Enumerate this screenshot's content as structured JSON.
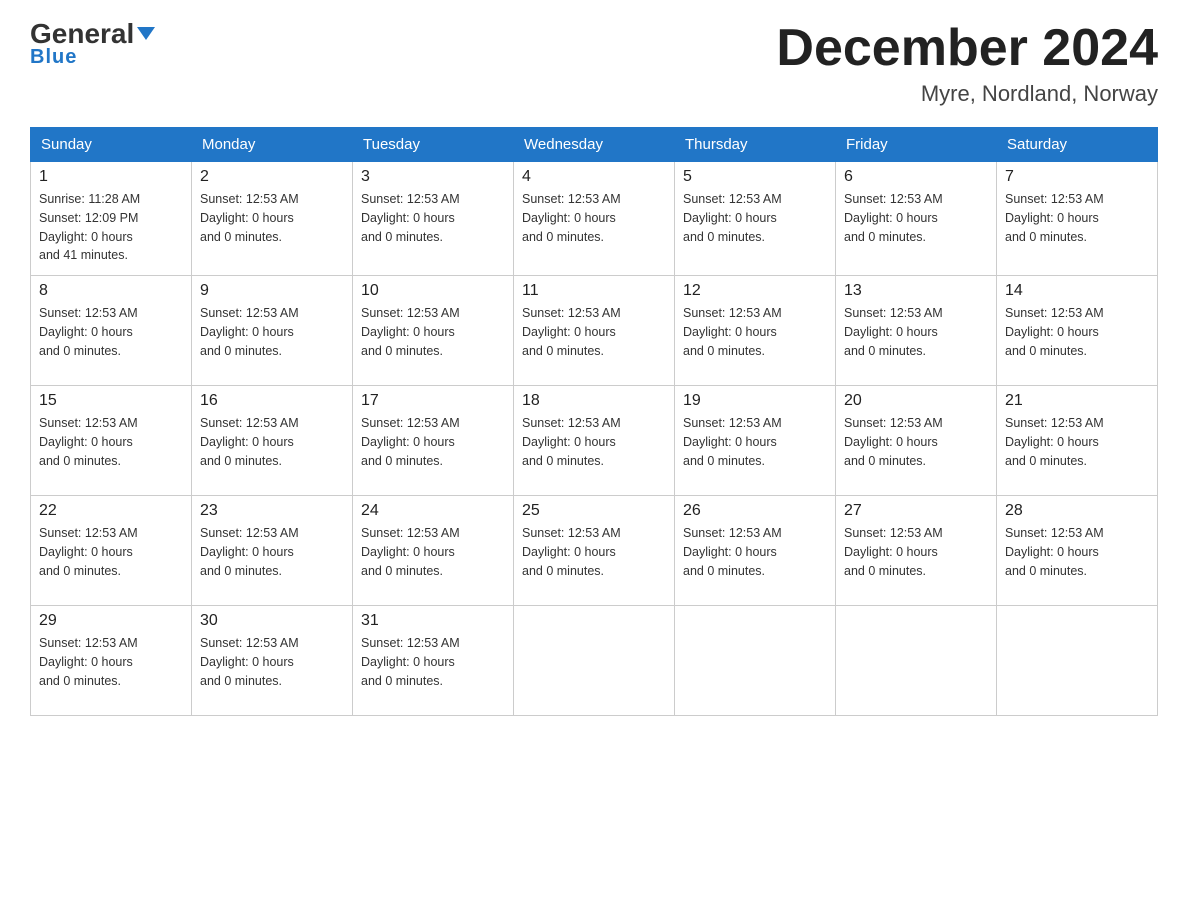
{
  "logo": {
    "general": "General",
    "blue": "Blue",
    "tagline": "Blue"
  },
  "header": {
    "month_year": "December 2024",
    "location": "Myre, Nordland, Norway"
  },
  "days_of_week": [
    "Sunday",
    "Monday",
    "Tuesday",
    "Wednesday",
    "Thursday",
    "Friday",
    "Saturday"
  ],
  "weeks": [
    {
      "days": [
        {
          "num": "1",
          "info": "Sunrise: 11:28 AM\nSunset: 12:09 PM\nDaylight: 0 hours\nand 41 minutes."
        },
        {
          "num": "2",
          "info": "Sunset: 12:53 AM\nDaylight: 0 hours\nand 0 minutes."
        },
        {
          "num": "3",
          "info": "Sunset: 12:53 AM\nDaylight: 0 hours\nand 0 minutes."
        },
        {
          "num": "4",
          "info": "Sunset: 12:53 AM\nDaylight: 0 hours\nand 0 minutes."
        },
        {
          "num": "5",
          "info": "Sunset: 12:53 AM\nDaylight: 0 hours\nand 0 minutes."
        },
        {
          "num": "6",
          "info": "Sunset: 12:53 AM\nDaylight: 0 hours\nand 0 minutes."
        },
        {
          "num": "7",
          "info": "Sunset: 12:53 AM\nDaylight: 0 hours\nand 0 minutes."
        }
      ]
    },
    {
      "days": [
        {
          "num": "8",
          "info": "Sunset: 12:53 AM\nDaylight: 0 hours\nand 0 minutes."
        },
        {
          "num": "9",
          "info": "Sunset: 12:53 AM\nDaylight: 0 hours\nand 0 minutes."
        },
        {
          "num": "10",
          "info": "Sunset: 12:53 AM\nDaylight: 0 hours\nand 0 minutes."
        },
        {
          "num": "11",
          "info": "Sunset: 12:53 AM\nDaylight: 0 hours\nand 0 minutes."
        },
        {
          "num": "12",
          "info": "Sunset: 12:53 AM\nDaylight: 0 hours\nand 0 minutes."
        },
        {
          "num": "13",
          "info": "Sunset: 12:53 AM\nDaylight: 0 hours\nand 0 minutes."
        },
        {
          "num": "14",
          "info": "Sunset: 12:53 AM\nDaylight: 0 hours\nand 0 minutes."
        }
      ]
    },
    {
      "days": [
        {
          "num": "15",
          "info": "Sunset: 12:53 AM\nDaylight: 0 hours\nand 0 minutes."
        },
        {
          "num": "16",
          "info": "Sunset: 12:53 AM\nDaylight: 0 hours\nand 0 minutes."
        },
        {
          "num": "17",
          "info": "Sunset: 12:53 AM\nDaylight: 0 hours\nand 0 minutes."
        },
        {
          "num": "18",
          "info": "Sunset: 12:53 AM\nDaylight: 0 hours\nand 0 minutes."
        },
        {
          "num": "19",
          "info": "Sunset: 12:53 AM\nDaylight: 0 hours\nand 0 minutes."
        },
        {
          "num": "20",
          "info": "Sunset: 12:53 AM\nDaylight: 0 hours\nand 0 minutes."
        },
        {
          "num": "21",
          "info": "Sunset: 12:53 AM\nDaylight: 0 hours\nand 0 minutes."
        }
      ]
    },
    {
      "days": [
        {
          "num": "22",
          "info": "Sunset: 12:53 AM\nDaylight: 0 hours\nand 0 minutes."
        },
        {
          "num": "23",
          "info": "Sunset: 12:53 AM\nDaylight: 0 hours\nand 0 minutes."
        },
        {
          "num": "24",
          "info": "Sunset: 12:53 AM\nDaylight: 0 hours\nand 0 minutes."
        },
        {
          "num": "25",
          "info": "Sunset: 12:53 AM\nDaylight: 0 hours\nand 0 minutes."
        },
        {
          "num": "26",
          "info": "Sunset: 12:53 AM\nDaylight: 0 hours\nand 0 minutes."
        },
        {
          "num": "27",
          "info": "Sunset: 12:53 AM\nDaylight: 0 hours\nand 0 minutes."
        },
        {
          "num": "28",
          "info": "Sunset: 12:53 AM\nDaylight: 0 hours\nand 0 minutes."
        }
      ]
    },
    {
      "days": [
        {
          "num": "29",
          "info": "Sunset: 12:53 AM\nDaylight: 0 hours\nand 0 minutes."
        },
        {
          "num": "30",
          "info": "Sunset: 12:53 AM\nDaylight: 0 hours\nand 0 minutes."
        },
        {
          "num": "31",
          "info": "Sunset: 12:53 AM\nDaylight: 0 hours\nand 0 minutes."
        },
        {
          "num": "",
          "info": ""
        },
        {
          "num": "",
          "info": ""
        },
        {
          "num": "",
          "info": ""
        },
        {
          "num": "",
          "info": ""
        }
      ]
    }
  ]
}
